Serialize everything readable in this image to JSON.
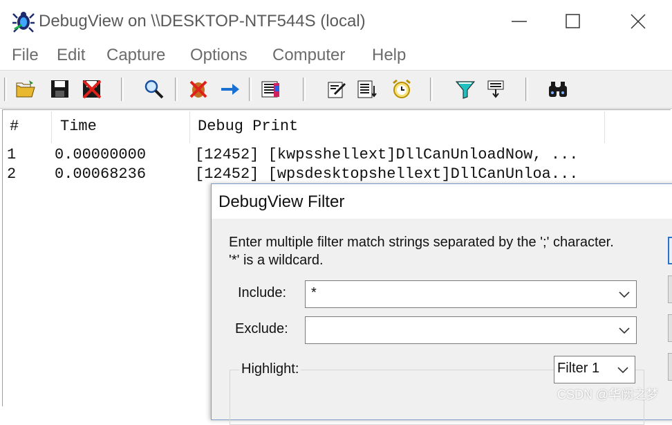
{
  "window": {
    "title": "DebugView on \\\\DESKTOP-NTF544S (local)"
  },
  "menu": [
    "File",
    "Edit",
    "Capture",
    "Options",
    "Computer",
    "Help"
  ],
  "toolbar": {
    "icons": [
      "open-icon",
      "save-icon",
      "clear-icon",
      "find-icon",
      "capture-toggle-icon",
      "autoscroll-icon",
      "history-icon",
      "clock-time-icon",
      "log-file-icon",
      "alarm-clock-icon",
      "filter-icon",
      "highlight-icon",
      "binoculars-icon"
    ]
  },
  "list": {
    "columns": [
      "#",
      "Time",
      "Debug Print"
    ],
    "rows": [
      {
        "num": "1",
        "time": "0.00000000",
        "text": "[12452] [kwpsshellext]DllCanUnloadNow, ..."
      },
      {
        "num": "2",
        "time": "0.00068236",
        "text": "[12452] [wpsdesktopshellext]DllCanUnloa..."
      }
    ]
  },
  "dialog": {
    "title": "DebugView Filter",
    "instructions_line1": "Enter multiple filter match strings separated by the ';' character.",
    "instructions_line2": "'*' is a wildcard.",
    "include_label": "Include:",
    "include_value": "*",
    "exclude_label": "Exclude:",
    "exclude_value": "",
    "highlight_label": "Highlight:",
    "highlight_filter": "Filter 1"
  },
  "watermark": "CSDN @华阙之梦",
  "colors": {
    "accent": "#2b72c8",
    "dialog_bg": "#f0f0f0",
    "toolbar_bg": "#f0f0f0"
  }
}
